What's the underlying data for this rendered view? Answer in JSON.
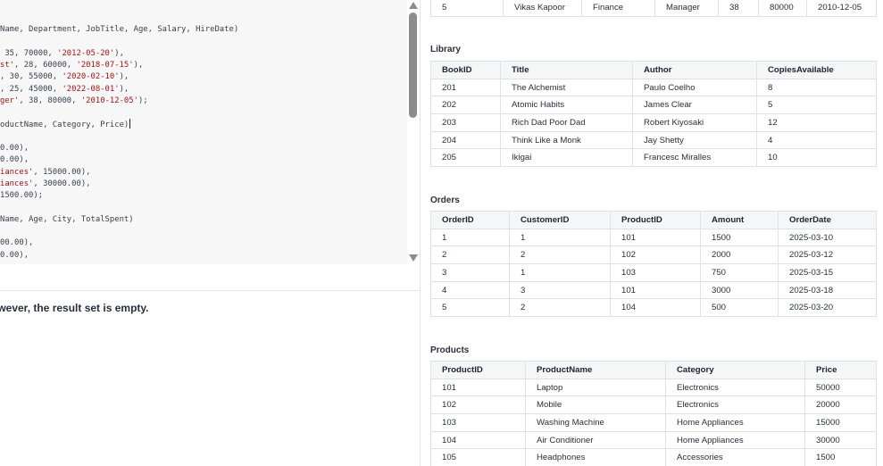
{
  "editor": {
    "lines": [
      [
        {
          "t": "Name, Department, JobTitle, Age, Salary, HireDate)"
        }
      ],
      [],
      [
        {
          "t": " 35, 70000, "
        },
        {
          "t": "'2012-05-20'",
          "s": true
        },
        {
          "t": "),"
        }
      ],
      [
        {
          "t": "st'",
          "s": true
        },
        {
          "t": ", 28, 60000, "
        },
        {
          "t": "'2018-07-15'",
          "s": true
        },
        {
          "t": "),"
        }
      ],
      [
        {
          "t": ", 30, 55000, "
        },
        {
          "t": "'2020-02-10'",
          "s": true
        },
        {
          "t": "),"
        }
      ],
      [
        {
          "t": ", 25, 45000, "
        },
        {
          "t": "'2022-08-01'",
          "s": true
        },
        {
          "t": "),"
        }
      ],
      [
        {
          "t": "ger'",
          "s": true
        },
        {
          "t": ", 38, 80000, "
        },
        {
          "t": "'2010-12-05'",
          "s": true
        },
        {
          "t": ");"
        }
      ],
      [],
      [
        {
          "t": "oductName, Category, Price)"
        }
      ],
      [],
      [
        {
          "t": "0.00),"
        }
      ],
      [
        {
          "t": "0.00),"
        }
      ],
      [
        {
          "t": "iances'",
          "s": true
        },
        {
          "t": ", 15000.00),"
        }
      ],
      [
        {
          "t": "iances'",
          "s": true
        },
        {
          "t": ", 30000.00),"
        }
      ],
      [
        {
          "t": "1500.00);"
        }
      ],
      [],
      [
        {
          "t": "Name, Age, City, TotalSpent)"
        }
      ],
      [],
      [
        {
          "t": "00.00),"
        }
      ],
      [
        {
          "t": "0.00),"
        }
      ]
    ]
  },
  "result_message": "owever, the result set is empty.",
  "tables": {
    "employees_partial": {
      "rows": [
        [
          "5",
          "Vikas Kapoor",
          "Finance",
          "Manager",
          "38",
          "80000",
          "2010-12-05"
        ]
      ]
    },
    "library": {
      "title": "Library",
      "columns": [
        "BookID",
        "Title",
        "Author",
        "CopiesAvailable"
      ],
      "rows": [
        [
          "201",
          "The Alchemist",
          "Paulo Coelho",
          "8"
        ],
        [
          "202",
          "Atomic Habits",
          "James Clear",
          "5"
        ],
        [
          "203",
          "Rich Dad Poor Dad",
          "Robert Kiyosaki",
          "12"
        ],
        [
          "204",
          "Think Like a Monk",
          "Jay Shetty",
          "4"
        ],
        [
          "205",
          "Ikigai",
          "Francesc Miralles",
          "10"
        ]
      ]
    },
    "orders": {
      "title": "Orders",
      "columns": [
        "OrderID",
        "CustomerID",
        "ProductID",
        "Amount",
        "OrderDate"
      ],
      "rows": [
        [
          "1",
          "1",
          "101",
          "1500",
          "2025-03-10"
        ],
        [
          "2",
          "2",
          "102",
          "2000",
          "2025-03-12"
        ],
        [
          "3",
          "1",
          "103",
          "750",
          "2025-03-15"
        ],
        [
          "4",
          "3",
          "101",
          "3000",
          "2025-03-18"
        ],
        [
          "5",
          "2",
          "104",
          "500",
          "2025-03-20"
        ]
      ]
    },
    "products": {
      "title": "Products",
      "columns": [
        "ProductID",
        "ProductName",
        "Category",
        "Price"
      ],
      "rows": [
        [
          "101",
          "Laptop",
          "Electronics",
          "50000"
        ],
        [
          "102",
          "Mobile",
          "Electronics",
          "20000"
        ],
        [
          "103",
          "Washing Machine",
          "Home Appliances",
          "15000"
        ],
        [
          "104",
          "Air Conditioner",
          "Home Appliances",
          "30000"
        ],
        [
          "105",
          "Headphones",
          "Accessories",
          "1500"
        ]
      ]
    }
  }
}
